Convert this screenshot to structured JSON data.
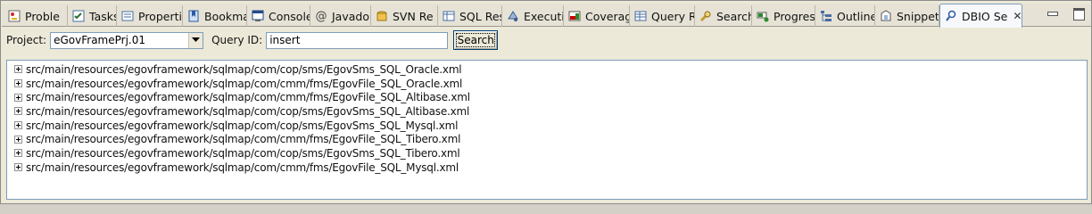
{
  "tabs": [
    {
      "label": "Proble",
      "icon": "problems-icon",
      "active": false
    },
    {
      "label": "Tasks",
      "icon": "tasks-icon",
      "active": false
    },
    {
      "label": "Properti",
      "icon": "properties-icon",
      "active": false
    },
    {
      "label": "Bookma",
      "icon": "bookmarks-icon",
      "active": false
    },
    {
      "label": "Console",
      "icon": "console-icon",
      "active": false
    },
    {
      "label": "Javado",
      "icon": "javadoc-icon",
      "active": false
    },
    {
      "label": "SVN Re",
      "icon": "svn-icon",
      "active": false
    },
    {
      "label": "SQL Res",
      "icon": "sql-results-icon",
      "active": false
    },
    {
      "label": "Executi",
      "icon": "execution-icon",
      "active": false
    },
    {
      "label": "Coverag",
      "icon": "coverage-icon",
      "active": false
    },
    {
      "label": "Query R",
      "icon": "query-results-icon",
      "active": false
    },
    {
      "label": "Search",
      "icon": "search-icon",
      "active": false
    },
    {
      "label": "Progres",
      "icon": "progress-icon",
      "active": false
    },
    {
      "label": "Outline",
      "icon": "outline-icon",
      "active": false
    },
    {
      "label": "Snippet",
      "icon": "snippet-icon",
      "active": false
    },
    {
      "label": "DBIO Se",
      "icon": "dbio-search-icon",
      "active": true
    }
  ],
  "toolbar": {
    "project_label": "Project:",
    "project_value": "eGovFramePrj.01",
    "query_id_label": "Query ID:",
    "query_id_value": "insert",
    "search_button": "Search"
  },
  "results": [
    "src/main/resources/egovframework/sqlmap/com/cop/sms/EgovSms_SQL_Oracle.xml",
    "src/main/resources/egovframework/sqlmap/com/cmm/fms/EgovFile_SQL_Oracle.xml",
    "src/main/resources/egovframework/sqlmap/com/cmm/fms/EgovFile_SQL_Altibase.xml",
    "src/main/resources/egovframework/sqlmap/com/cop/sms/EgovSms_SQL_Altibase.xml",
    "src/main/resources/egovframework/sqlmap/com/cop/sms/EgovSms_SQL_Mysql.xml",
    "src/main/resources/egovframework/sqlmap/com/cmm/fms/EgovFile_SQL_Tibero.xml",
    "src/main/resources/egovframework/sqlmap/com/cop/sms/EgovSms_SQL_Tibero.xml",
    "src/main/resources/egovframework/sqlmap/com/cmm/fms/EgovFile_SQL_Mysql.xml"
  ],
  "colors": {
    "accent": "#7f9db9",
    "tab_bg": "#e6e3d6",
    "active_tab_bg": "#f7f8fb"
  }
}
